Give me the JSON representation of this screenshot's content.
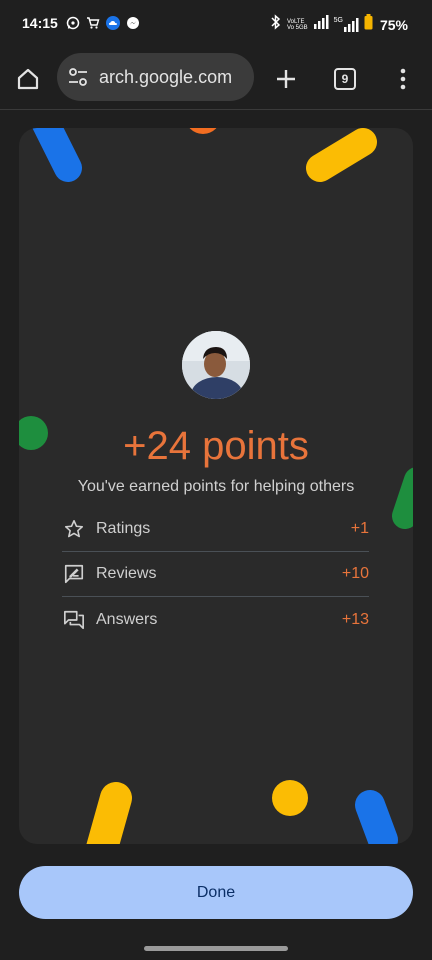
{
  "status_bar": {
    "time": "14:15",
    "left_icons": [
      "whatsapp-icon",
      "shopping-cart-icon",
      "cloud-icon",
      "messenger-icon"
    ],
    "right_icons": [
      "bluetooth-icon",
      "volte-icon",
      "signal-icon",
      "5g-signal-icon",
      "battery-icon"
    ],
    "volte_line1": "VoLTE",
    "volte_line2": "Vo 5GB",
    "network": "5G",
    "battery": "75%"
  },
  "browser": {
    "url": "arch.google.com",
    "tab_count": "9"
  },
  "card": {
    "points_text": "+24 points",
    "subtitle": "You've earned points for helping others",
    "rows": [
      {
        "icon": "star-icon",
        "label": "Ratings",
        "value": "+1"
      },
      {
        "icon": "rate-review-icon",
        "label": "Reviews",
        "value": "+10"
      },
      {
        "icon": "forum-icon",
        "label": "Answers",
        "value": "+13"
      }
    ]
  },
  "done_label": "Done",
  "colors": {
    "accent_orange": "#e8743b",
    "button_bg": "#a8c7fa",
    "button_text": "#0b2f66",
    "blue": "#1a73e8",
    "yellow": "#fbbc04",
    "green": "#1e8e3e",
    "orange": "#f26d21"
  }
}
